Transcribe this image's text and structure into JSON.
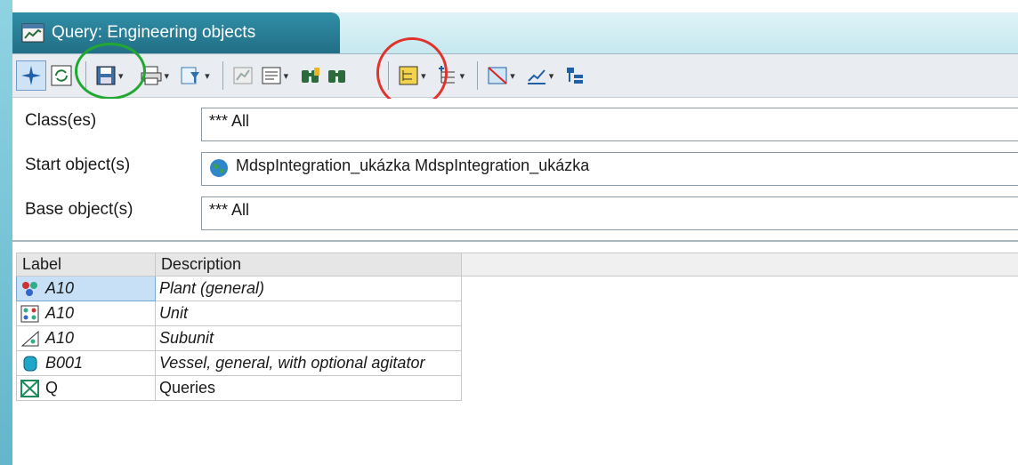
{
  "window": {
    "tab_title": "Query: Engineering objects",
    "tab_icon": "query-window-icon"
  },
  "toolbar": {
    "buttons": [
      {
        "name": "navigate-icon",
        "dropdown": false
      },
      {
        "name": "refresh-icon",
        "dropdown": false
      },
      {
        "name": "save-icon",
        "dropdown": true
      },
      {
        "name": "print-icon",
        "dropdown": true
      },
      {
        "name": "filter-icon",
        "dropdown": true
      },
      {
        "name": "chart-icon",
        "dropdown": false
      },
      {
        "name": "properties-icon",
        "dropdown": true
      },
      {
        "name": "find-icon",
        "dropdown": false
      },
      {
        "name": "find-next-icon",
        "dropdown": false
      },
      {
        "name": "tree-view-icon",
        "dropdown": true
      },
      {
        "name": "hierarchy-icon",
        "dropdown": true
      },
      {
        "name": "clear-icon",
        "dropdown": true
      },
      {
        "name": "edit-icon",
        "dropdown": true
      },
      {
        "name": "structure-icon",
        "dropdown": false
      }
    ]
  },
  "form": {
    "classes": {
      "label": "Class(es)",
      "value": "*** All"
    },
    "start_objects": {
      "label": "Start object(s)",
      "value": "MdspIntegration_ukázka   MdspIntegration_ukázka"
    },
    "base_objects": {
      "label": "Base object(s)",
      "value": "*** All"
    }
  },
  "table": {
    "columns": [
      "Label",
      "Description"
    ],
    "rows": [
      {
        "label": "A10",
        "description": "Plant (general)",
        "icon": "plant-icon",
        "selected": true
      },
      {
        "label": "A10",
        "description": "Unit",
        "icon": "unit-icon",
        "selected": false
      },
      {
        "label": "A10",
        "description": "Subunit",
        "icon": "subunit-icon",
        "selected": false
      },
      {
        "label": "B001",
        "description": "Vessel, general, with optional agitator",
        "icon": "vessel-icon",
        "selected": false
      },
      {
        "label": "Q",
        "description": "Queries",
        "icon": "queries-icon",
        "selected": false
      }
    ]
  },
  "colors": {
    "tab": "#2f8ea6",
    "highlight_red": "#e0332c",
    "highlight_green": "#22a832"
  }
}
